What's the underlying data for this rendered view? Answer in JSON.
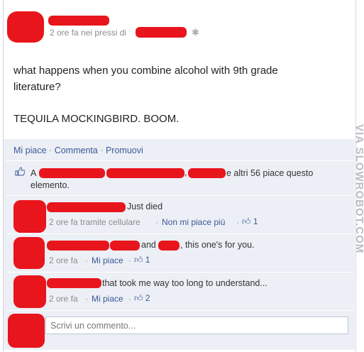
{
  "post": {
    "time_text": "2 ore fa nei pressi di",
    "text_line1": "what happens when you combine alcohol with 9th grade",
    "text_line2": "literature?",
    "text_line3": "TEQUILA MOCKINGBIRD. BOOM.",
    "gear_icon": "gear-icon"
  },
  "actions": {
    "like": "Mi piace",
    "comment": "Commenta",
    "promote": "Promuovi",
    "separator": "·"
  },
  "likes": {
    "prefix": "A",
    "comma": ",",
    "others_text": "e altri 56 piace questo",
    "line2": "elemento."
  },
  "comments": [
    {
      "text": "Just died",
      "time": "2 ore fa tramite cellulare",
      "action": "Non mi piace più",
      "likes": "1"
    },
    {
      "text_and": "and",
      "text": ", this one's for you.",
      "time": "2 ore fa",
      "action": "Mi piace",
      "likes": "1"
    },
    {
      "text": "that took me way too long to understand...",
      "time": "2 ore fa",
      "action": "Mi piace",
      "likes": "2"
    }
  ],
  "comment_input": {
    "placeholder": "Scrivi un commento..."
  },
  "watermark": "VIA SLOWROBOT.COM",
  "colors": {
    "link": "#3b5998",
    "redaction": "#e8151c",
    "feedback_bg": "#eceff5"
  }
}
